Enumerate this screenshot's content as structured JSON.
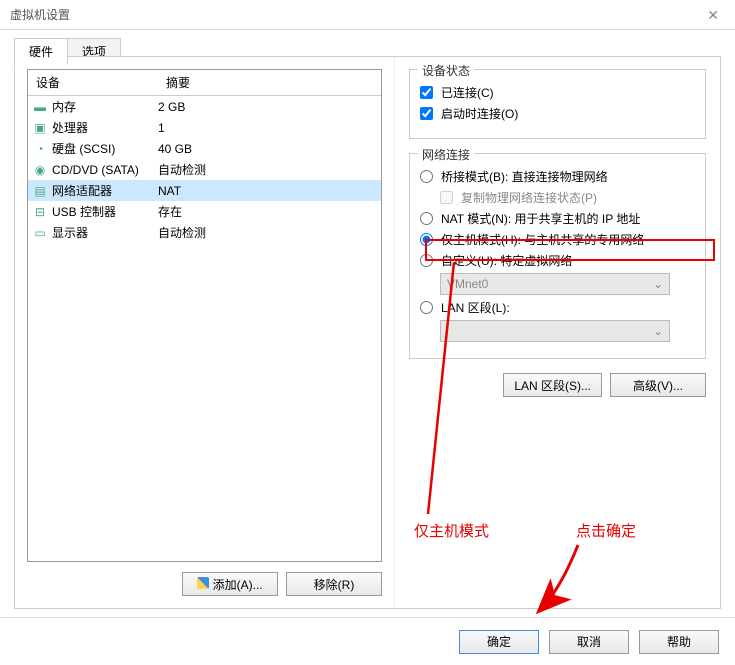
{
  "title": "虚拟机设置",
  "tabs": {
    "hardware": "硬件",
    "options": "选项"
  },
  "table": {
    "header_device": "设备",
    "header_summary": "摘要",
    "rows": [
      {
        "icon": "memory",
        "device": "内存",
        "summary": "2 GB"
      },
      {
        "icon": "cpu",
        "device": "处理器",
        "summary": "1"
      },
      {
        "icon": "disk",
        "device": "硬盘 (SCSI)",
        "summary": "40 GB"
      },
      {
        "icon": "disc",
        "device": "CD/DVD (SATA)",
        "summary": "自动检测"
      },
      {
        "icon": "net",
        "device": "网络适配器",
        "summary": "NAT",
        "selected": true
      },
      {
        "icon": "usb",
        "device": "USB 控制器",
        "summary": "存在"
      },
      {
        "icon": "display",
        "device": "显示器",
        "summary": "自动检测"
      }
    ]
  },
  "left_buttons": {
    "add": "添加(A)...",
    "remove": "移除(R)"
  },
  "group_status": {
    "title": "设备状态",
    "connected": "已连接(C)",
    "connect_at_power": "启动时连接(O)"
  },
  "group_network": {
    "title": "网络连接",
    "bridged": "桥接模式(B): 直接连接物理网络",
    "replicate": "复制物理网络连接状态(P)",
    "nat": "NAT 模式(N): 用于共享主机的 IP 地址",
    "hostonly": "仅主机模式(H): 与主机共享的专用网络",
    "custom": "自定义(U): 特定虚拟网络",
    "custom_select": "VMnet0",
    "lan": "LAN 区段(L):",
    "lan_segments_btn": "LAN 区段(S)...",
    "advanced_btn": "高级(V)..."
  },
  "bottom": {
    "ok": "确定",
    "cancel": "取消",
    "help": "帮助"
  },
  "annotations": {
    "left": "仅主机模式",
    "right": "点击确定"
  }
}
